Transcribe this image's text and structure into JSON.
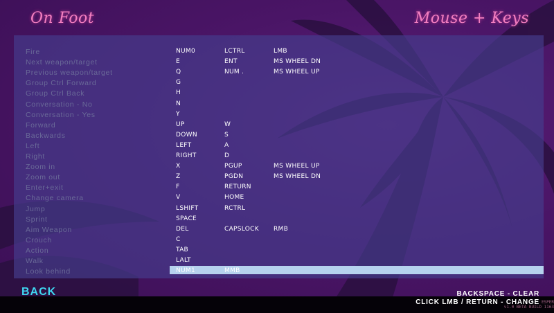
{
  "header": {
    "left_title": "On Foot",
    "right_title": "Mouse + Keys"
  },
  "rows": [
    {
      "action": "Fire",
      "k1": "NUM0",
      "k2": "LCTRL",
      "k3": "LMB"
    },
    {
      "action": "Next weapon/target",
      "k1": "E",
      "k2": "ENT",
      "k3": "MS WHEEL DN"
    },
    {
      "action": "Previous weapon/target",
      "k1": "Q",
      "k2": "NUM .",
      "k3": "MS WHEEL UP"
    },
    {
      "action": "Group Ctrl Forward",
      "k1": "G",
      "k2": "",
      "k3": ""
    },
    {
      "action": "Group Ctrl Back",
      "k1": "H",
      "k2": "",
      "k3": ""
    },
    {
      "action": "Conversation - No",
      "k1": "N",
      "k2": "",
      "k3": ""
    },
    {
      "action": "Conversation - Yes",
      "k1": "Y",
      "k2": "",
      "k3": ""
    },
    {
      "action": "Forward",
      "k1": "UP",
      "k2": "W",
      "k3": ""
    },
    {
      "action": "Backwards",
      "k1": "DOWN",
      "k2": "S",
      "k3": ""
    },
    {
      "action": "Left",
      "k1": "LEFT",
      "k2": "A",
      "k3": ""
    },
    {
      "action": "Right",
      "k1": "RIGHT",
      "k2": "D",
      "k3": ""
    },
    {
      "action": "Zoom in",
      "k1": "X",
      "k2": "PGUP",
      "k3": "MS WHEEL UP"
    },
    {
      "action": "Zoom out",
      "k1": "Z",
      "k2": "PGDN",
      "k3": "MS WHEEL DN"
    },
    {
      "action": "Enter+exit",
      "k1": "F",
      "k2": "RETURN",
      "k3": ""
    },
    {
      "action": "Change camera",
      "k1": "V",
      "k2": "HOME",
      "k3": ""
    },
    {
      "action": "Jump",
      "k1": "LSHIFT",
      "k2": "RCTRL",
      "k3": ""
    },
    {
      "action": "Sprint",
      "k1": "SPACE",
      "k2": "",
      "k3": ""
    },
    {
      "action": "Aim Weapon",
      "k1": "DEL",
      "k2": "CAPSLOCK",
      "k3": "RMB"
    },
    {
      "action": "Crouch",
      "k1": "C",
      "k2": "",
      "k3": ""
    },
    {
      "action": "Action",
      "k1": "TAB",
      "k2": "",
      "k3": ""
    },
    {
      "action": "Walk",
      "k1": "LALT",
      "k2": "",
      "k3": ""
    },
    {
      "action": "Look behind",
      "k1": "NUM1",
      "k2": "MMB",
      "k3": "",
      "selected": true
    }
  ],
  "footer": {
    "back_label": "BACK",
    "hint_clear": "BACKSPACE - CLEAR",
    "hint_change": "CLICK LMB / RETURN - CHANGE",
    "build_line1": "ESPER",
    "build_line2": "v1.0 BETA BUILD 1163"
  },
  "colors": {
    "title": "#f27fc0",
    "back": "#3fd6f0",
    "selected_row": "#b6d2ee",
    "action_text": "#6a6a98"
  }
}
